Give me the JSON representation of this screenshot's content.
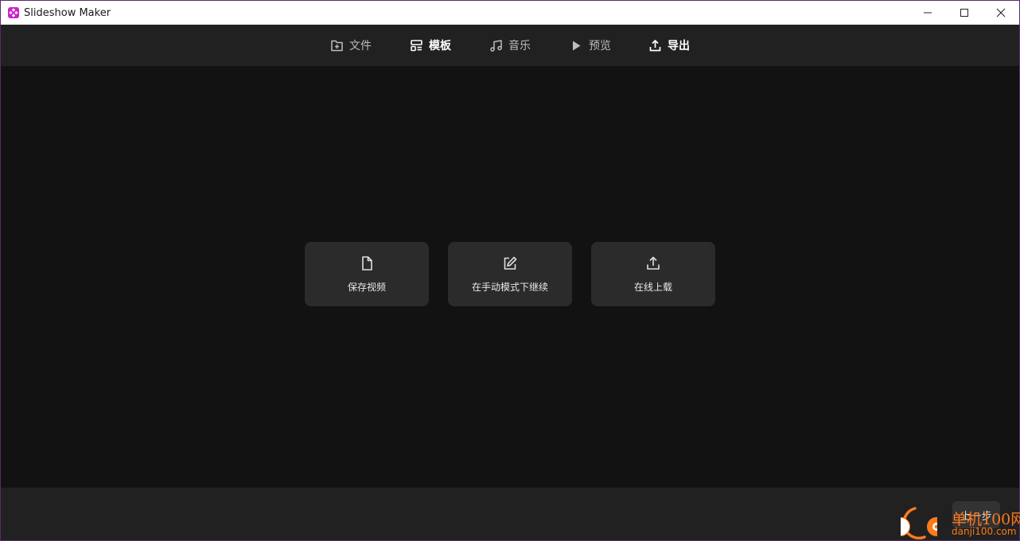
{
  "window": {
    "title": "Slideshow Maker"
  },
  "nav": {
    "items": [
      {
        "label": "文件",
        "icon": "file-plus-icon"
      },
      {
        "label": "模板",
        "icon": "template-icon"
      },
      {
        "label": "音乐",
        "icon": "music-note-icon"
      },
      {
        "label": "预览",
        "icon": "play-icon"
      },
      {
        "label": "导出",
        "icon": "export-icon"
      }
    ],
    "active": "导出"
  },
  "export_options": [
    {
      "label": "保存视频",
      "icon": "file-icon"
    },
    {
      "label": "在手动模式下继续",
      "icon": "edit-icon"
    },
    {
      "label": "在线上载",
      "icon": "upload-icon"
    }
  ],
  "footer": {
    "prev_label": "上一步"
  },
  "watermark": {
    "brand": "单机100网",
    "domain": "danji100.com"
  },
  "colors": {
    "accent": "#cc22cc",
    "background": "#121212",
    "panel": "#212121",
    "card": "#2b2b2b",
    "watermark": "#ff7a1a"
  }
}
